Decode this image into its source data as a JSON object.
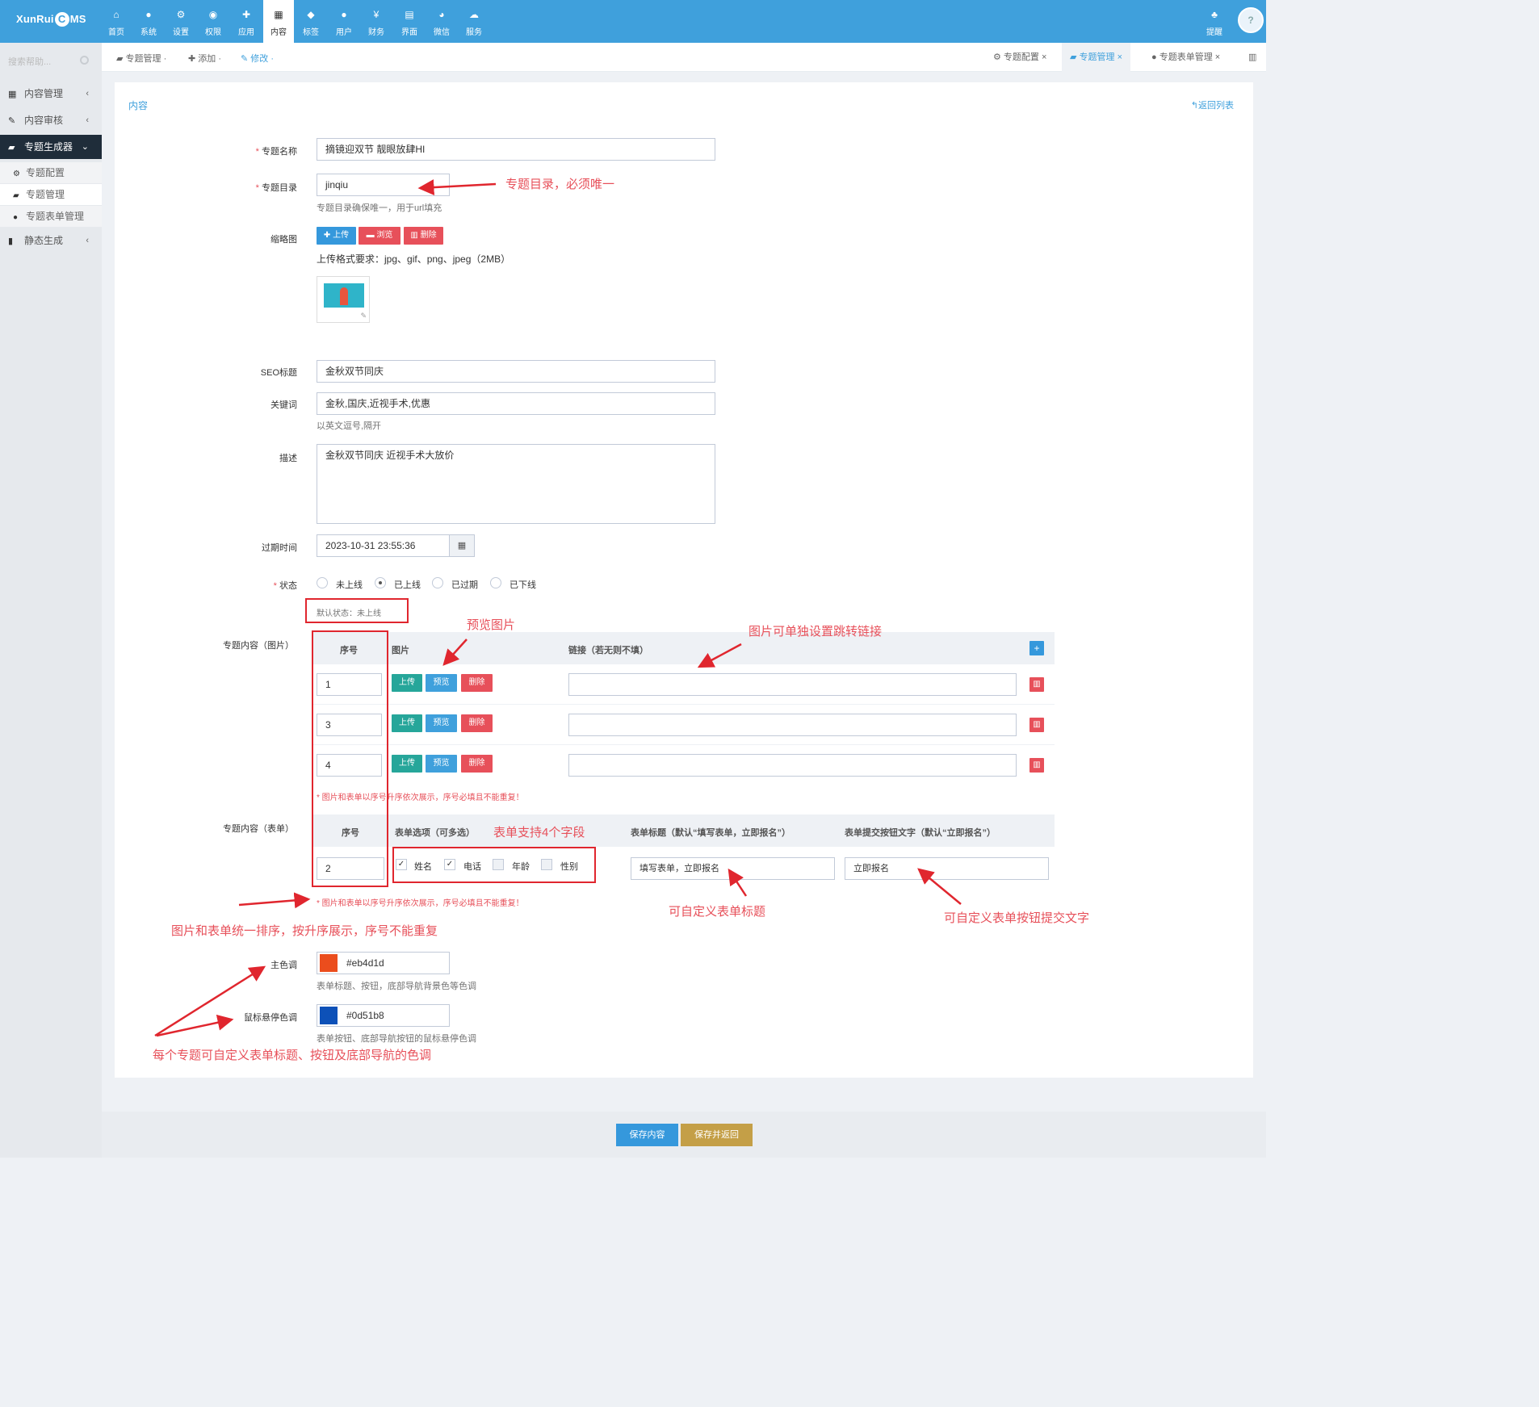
{
  "top_nav": {
    "logo_a": "XunRui",
    "logo_c": "C",
    "logo_b": "MS",
    "items": [
      {
        "icon": "home-icon",
        "label": "首页"
      },
      {
        "icon": "globe-icon",
        "label": "系统"
      },
      {
        "icon": "cogs-icon",
        "label": "设置"
      },
      {
        "icon": "user-circle-icon",
        "label": "权限"
      },
      {
        "icon": "puzzle-icon",
        "label": "应用"
      },
      {
        "icon": "grid-icon",
        "label": "内容"
      },
      {
        "icon": "tag-icon",
        "label": "标签"
      },
      {
        "icon": "user-icon",
        "label": "用户"
      },
      {
        "icon": "yen-icon",
        "label": "财务"
      },
      {
        "icon": "layout-icon",
        "label": "界面"
      },
      {
        "icon": "wechat-icon",
        "label": "微信"
      },
      {
        "icon": "cloud-icon",
        "label": "服务"
      }
    ],
    "active_index": 5,
    "bell_label": "提醒",
    "avatar_text": "?"
  },
  "sidebar": {
    "search_placeholder": "搜索帮助...",
    "menu": [
      {
        "label": "内容管理",
        "icon": "grid-icon"
      },
      {
        "label": "内容审核",
        "icon": "edit-icon"
      },
      {
        "label": "专题生成器",
        "icon": "book-icon"
      }
    ],
    "submenu": [
      {
        "label": "专题配置",
        "icon": "gear-icon"
      },
      {
        "label": "专题管理",
        "icon": "book-icon"
      },
      {
        "label": "专题表单管理",
        "icon": "user-icon"
      }
    ],
    "static_label": "静态生成"
  },
  "tabbar": {
    "crumb_manage": "专题管理",
    "crumb_add": "添加",
    "crumb_edit": "修改",
    "tabs": [
      "专题配置",
      "专题管理",
      "专题表单管理"
    ]
  },
  "panel": {
    "title": "内容",
    "back": "返回列表"
  },
  "form": {
    "name_label": "专题名称",
    "name_value": "摘镜迎双节 靓眼放肆HI",
    "dir_label": "专题目录",
    "dir_value": "jinqiu",
    "dir_help": "专题目录确保唯一，用于url填充",
    "thumb_label": "缩略图",
    "btn_upload": "上传",
    "btn_browse": "浏览",
    "btn_delete": "删除",
    "thumb_help": "上传格式要求：jpg、gif、png、jpeg（2MB）",
    "seo_label": "SEO标题",
    "seo_value": "金秋双节同庆",
    "kw_label": "关键词",
    "kw_value": "金秋,国庆,近视手术,优惠",
    "kw_help": "以英文逗号,隔开",
    "desc_label": "描述",
    "desc_value": "金秋双节同庆 近视手术大放价",
    "expire_label": "过期时间",
    "expire_value": "2023-10-31 23:55:36",
    "status_label": "状态",
    "status_options": [
      "未上线",
      "已上线",
      "已过期",
      "已下线"
    ],
    "status_selected": 1,
    "status_default": "默认状态：未上线"
  },
  "image_table": {
    "label": "专题内容（图片）",
    "col_no": "序号",
    "col_img": "图片",
    "col_link": "链接（若无则不填）",
    "rows": [
      {
        "no": "1",
        "link": ""
      },
      {
        "no": "3",
        "link": ""
      },
      {
        "no": "4",
        "link": ""
      }
    ],
    "btn_upload": "上传",
    "btn_preview": "预览",
    "btn_delete": "删除",
    "note": "* 图片和表单以序号升序依次展示，序号必填且不能重复！"
  },
  "form_table": {
    "label": "专题内容（表单）",
    "col_no": "序号",
    "col_opts": "表单选项（可多选）",
    "col_title": "表单标题（默认“填写表单，立即报名”）",
    "col_btn": "表单提交按钮文字（默认“立即报名”）",
    "no_value": "2",
    "options": [
      {
        "label": "姓名",
        "checked": true
      },
      {
        "label": "电话",
        "checked": true
      },
      {
        "label": "年龄",
        "checked": false
      },
      {
        "label": "性别",
        "checked": false
      }
    ],
    "title_value": "填写表单，立即报名",
    "btn_value": "立即报名",
    "note": "* 图片和表单以序号升序依次展示，序号必填且不能重复！"
  },
  "colors": {
    "main_label": "主色调",
    "main_value": "#eb4d1d",
    "main_help": "表单标题、按钮，底部导航背景色等色调",
    "hover_label": "鼠标悬停色调",
    "hover_value": "#0d51b8",
    "hover_help": "表单按钮、底部导航按钮的鼠标悬停色调"
  },
  "annotations": {
    "dir_unique": "专题目录，必须唯一",
    "preview_img": "预览图片",
    "img_link": "图片可单独设置跳转链接",
    "form_fields": "表单支持4个字段",
    "sort_rule": "图片和表单统一排序，按升序展示，序号不能重复",
    "custom_title": "可自定义表单标题",
    "custom_btn": "可自定义表单按钮提交文字",
    "custom_colors": "每个专题可自定义表单标题、按钮及底部导航的色调"
  },
  "footer": {
    "save": "保存内容",
    "save_back": "保存并返回"
  }
}
